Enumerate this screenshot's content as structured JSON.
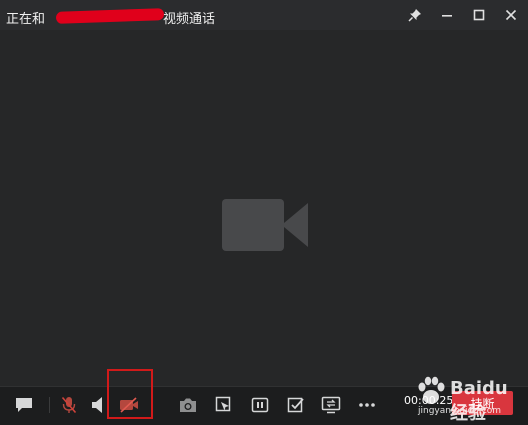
{
  "window": {
    "title_prefix": "正在和",
    "title_suffix": "视频通话"
  },
  "toolbar": {
    "timer": "00:00:25",
    "hangup_label": "挂断"
  },
  "watermark": {
    "text": "Baidu 经验",
    "sub": "jingyan.baidu.com"
  },
  "colors": {
    "background": "#262728",
    "toolbar": "#1c1d1e",
    "hangup": "#d9363e",
    "highlight": "#d11a1a",
    "icon": "#cfd0d1",
    "icon_muted": "#c0392b"
  },
  "icons": {
    "chat": "chat-bubble",
    "mic": "mic-off",
    "speaker": "speaker",
    "camera": "camera-off",
    "screenshot": "camera",
    "snip": "crop-select",
    "pause": "pause-box",
    "check": "check-box",
    "swap": "screen-share",
    "more": "ellipsis"
  }
}
